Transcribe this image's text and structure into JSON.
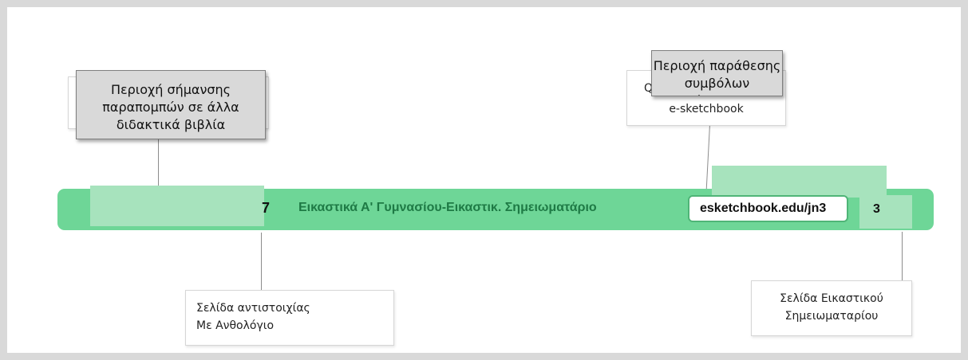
{
  "callouts": {
    "references": {
      "line1": "Περιοχή σήμανσης",
      "line2": "παραπομπών σε άλλα",
      "line3": "διδακτικά βιβλία"
    },
    "symbols": {
      "line1": "Περιοχή παράθεσης",
      "line2": "συμβόλων σήμανσης"
    }
  },
  "labels": {
    "qr_partial": "Q",
    "esketchbook": "e-sketchbook",
    "anthology_page": {
      "line1": "Σελίδα αντιστοιχίας",
      "line2": "Με Ανθολόγιο"
    },
    "notebook_page": {
      "line1": "Σελίδα Εικαστικού",
      "line2": "Σημειωματαρίου"
    }
  },
  "bar": {
    "page_number_left": "7",
    "title": "Εικαστικά Α' Γυμνασίου-Εικαστικ. Σημειωματάριο",
    "url": "esketchbook.edu/jn3",
    "page_number_right": "3"
  },
  "colors": {
    "bar_green": "#6ed697",
    "pale_green": "#a7e3bd",
    "title_green": "#1e7a45",
    "callout_gray": "#d9d9d9",
    "frame_gray": "#d9d9d9"
  }
}
